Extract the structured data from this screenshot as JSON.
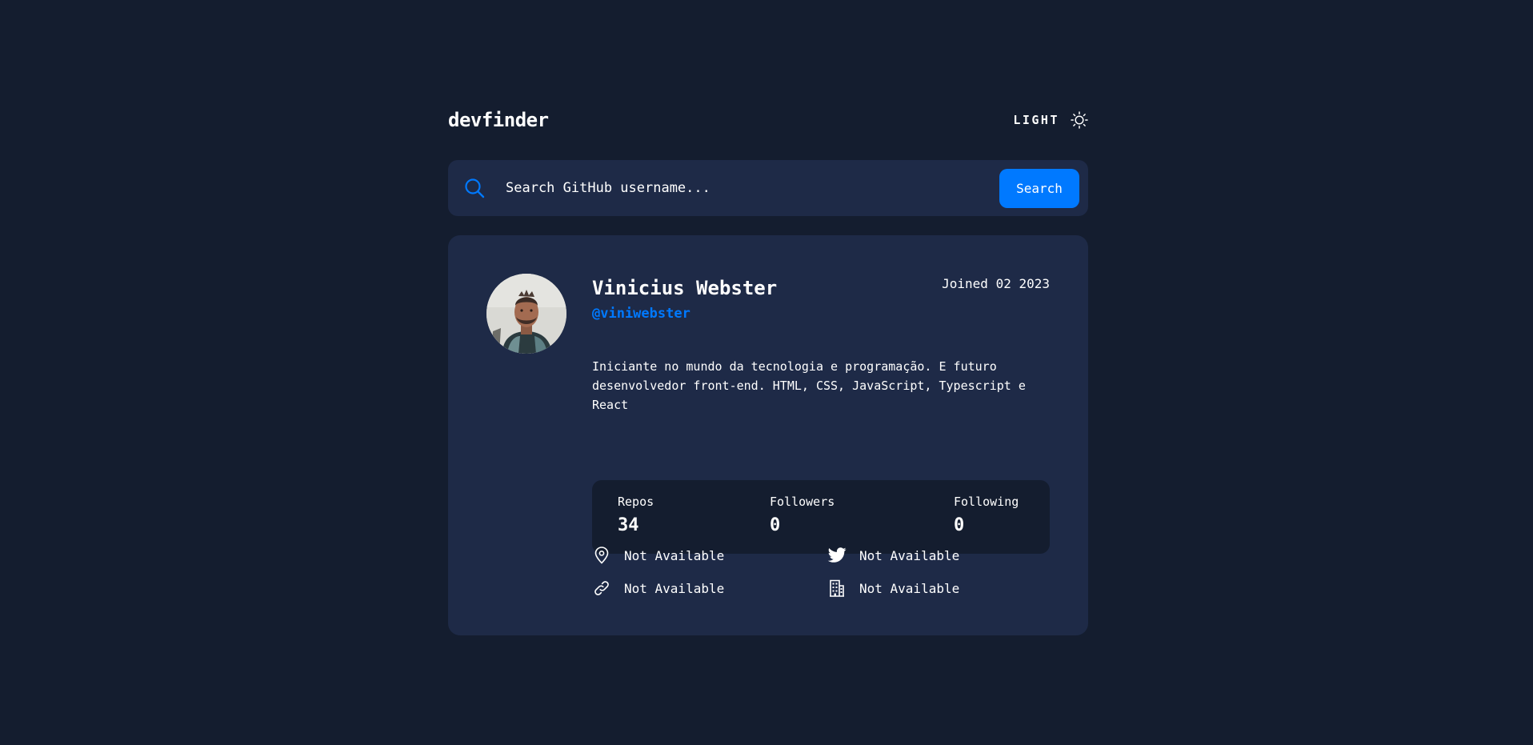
{
  "app": {
    "logo": "devfinder",
    "theme_toggle_label": "LIGHT",
    "theme_icon": "sun-icon"
  },
  "search": {
    "placeholder": "Search GitHub username...",
    "value": "",
    "button_label": "Search",
    "icon": "search-icon"
  },
  "profile": {
    "name": "Vinicius Webster",
    "login": "@viniwebster",
    "joined": "Joined 02 2023",
    "bio": "Iniciante no mundo da tecnologia e programação. E futuro desenvolvedor front-end. HTML, CSS, JavaScript, Typescript e React",
    "stats": [
      {
        "label": "Repos",
        "value": "34"
      },
      {
        "label": "Followers",
        "value": "0"
      },
      {
        "label": "Following",
        "value": "0"
      }
    ],
    "links": {
      "location": {
        "icon": "location-pin-icon",
        "text": "Not Available"
      },
      "twitter": {
        "icon": "twitter-icon",
        "text": "Not Available"
      },
      "blog": {
        "icon": "link-icon",
        "text": "Not Available"
      },
      "company": {
        "icon": "building-icon",
        "text": "Not Available"
      }
    }
  },
  "colors": {
    "background": "#141d2f",
    "card": "#1e2a47",
    "accent": "#0079ff",
    "text": "#ffffff"
  }
}
